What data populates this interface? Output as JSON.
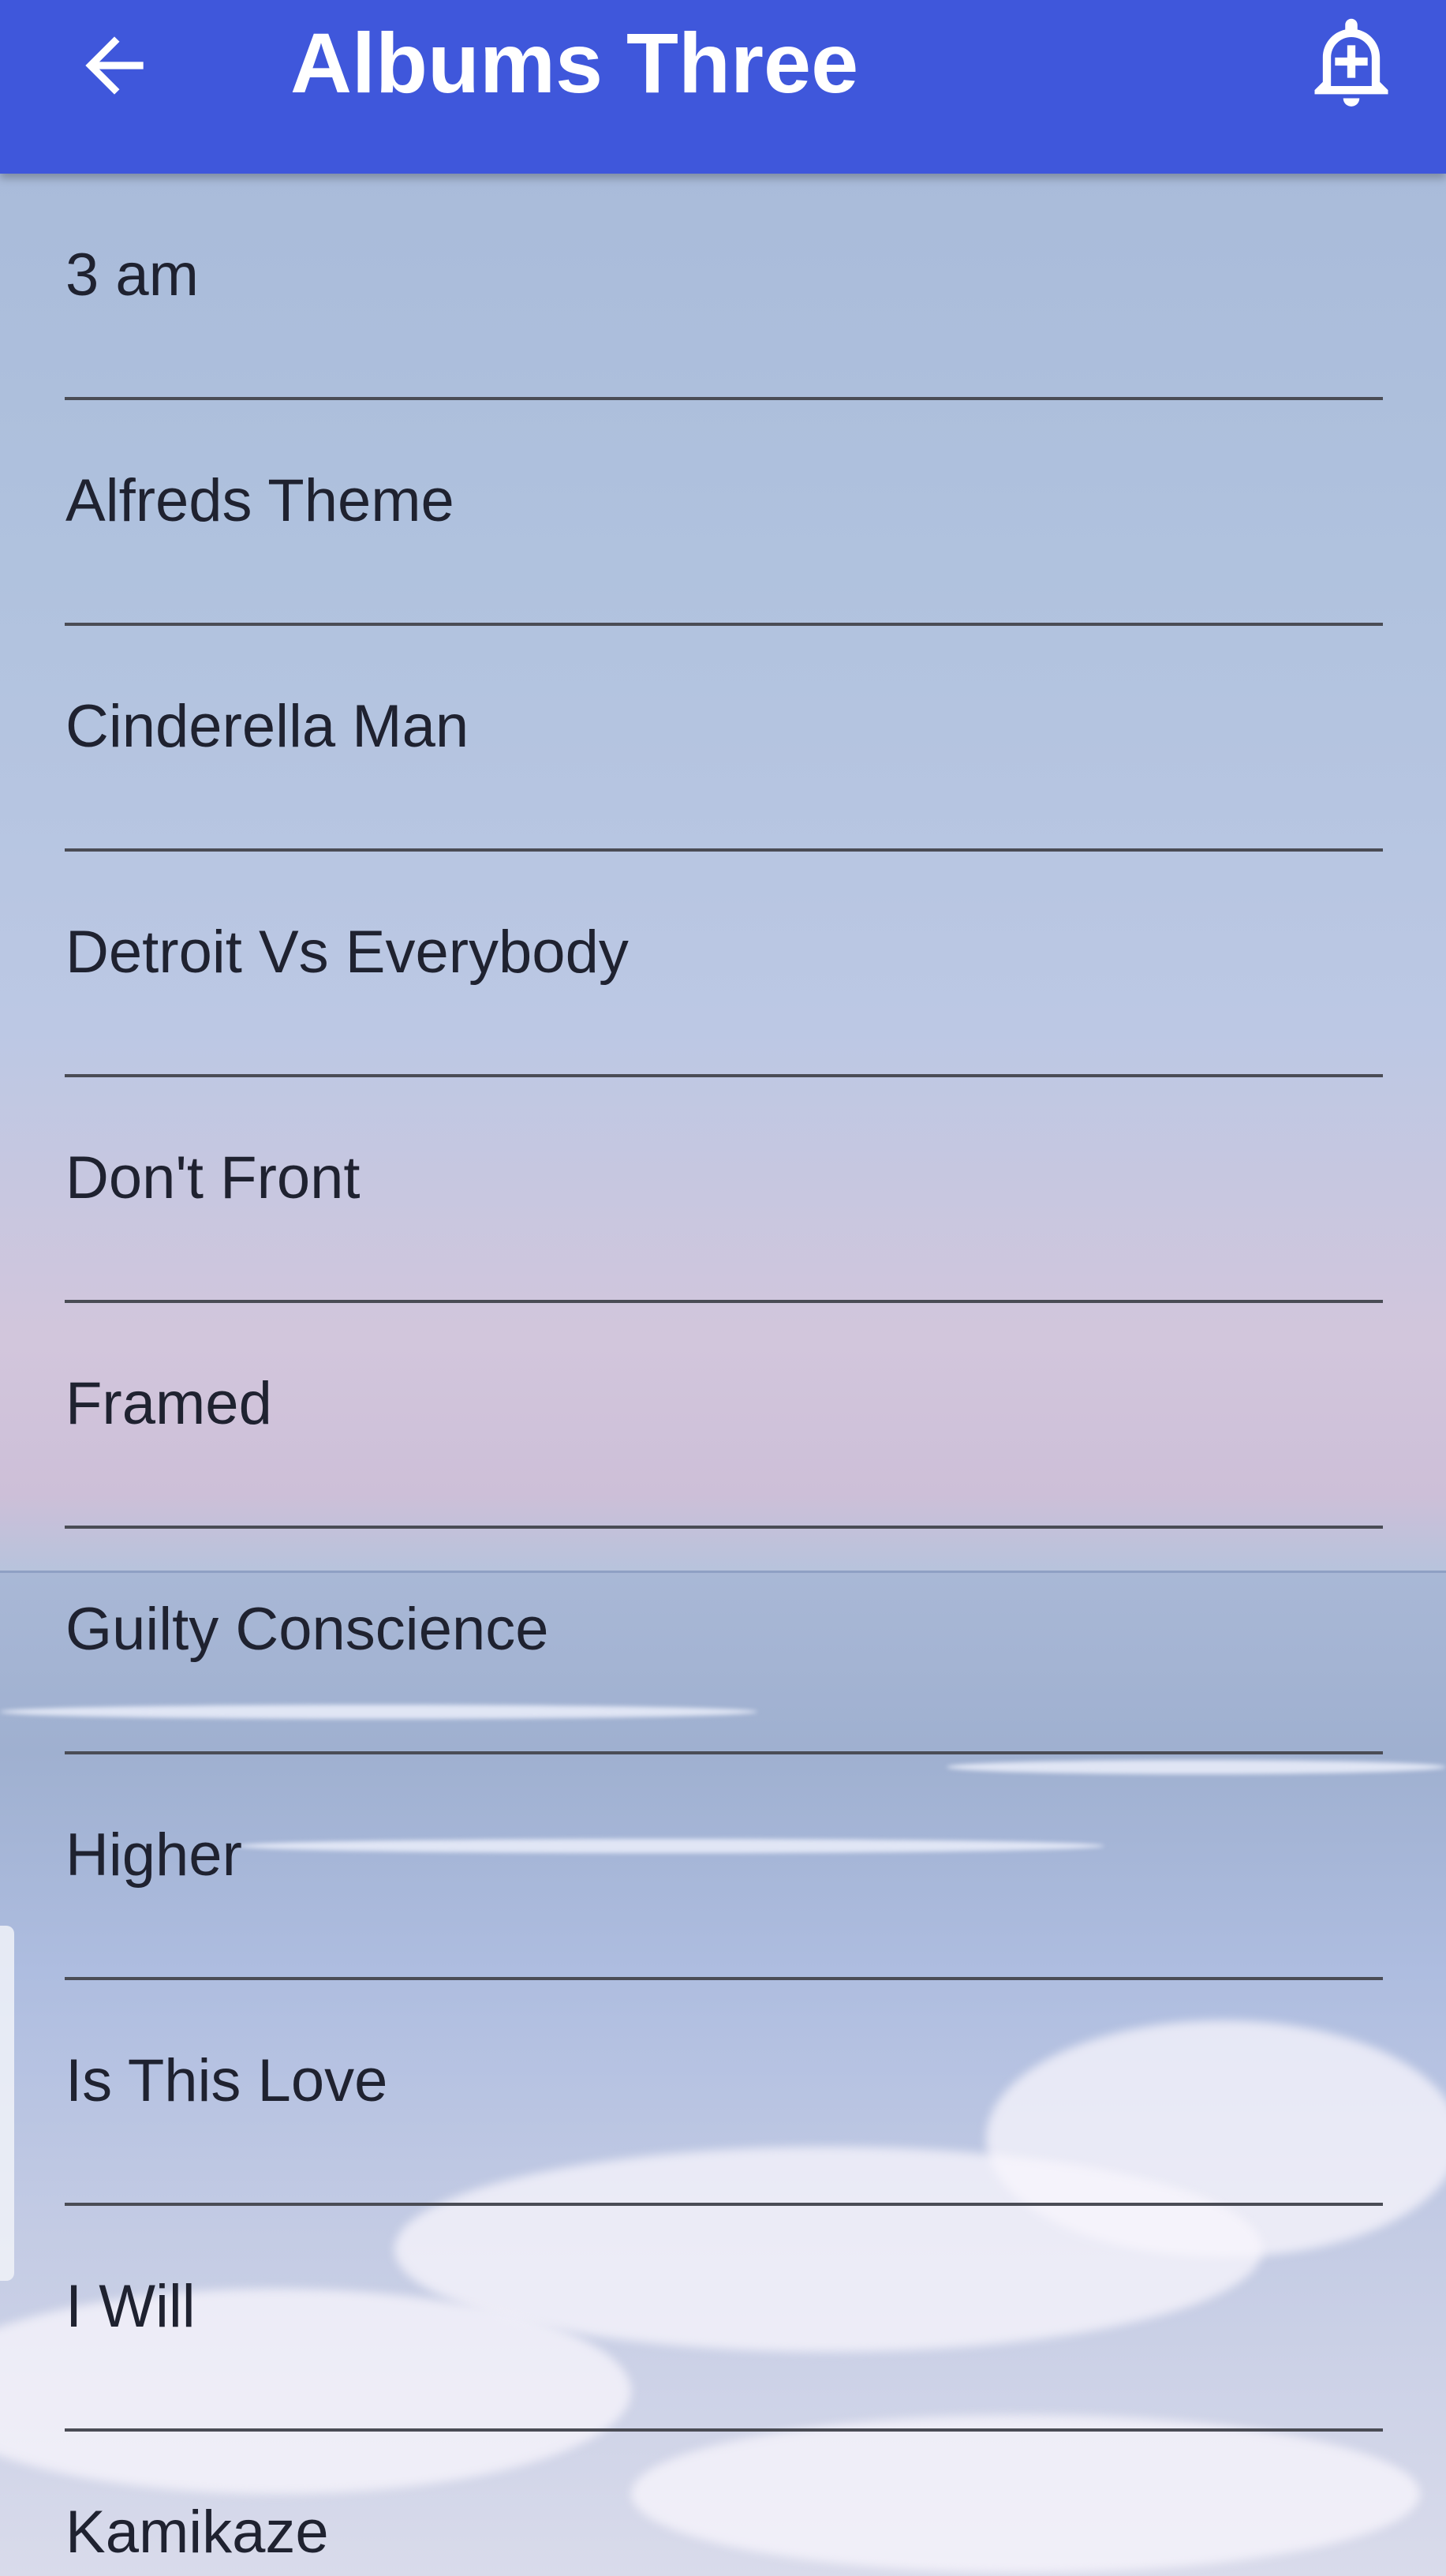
{
  "header": {
    "title": "Albums Three",
    "back_icon": "arrow-back-icon",
    "action_icon": "alarm-add-icon",
    "background_color": "#3f57db"
  },
  "songs": [
    {
      "label": "3 am"
    },
    {
      "label": "Alfreds Theme"
    },
    {
      "label": "Cinderella Man"
    },
    {
      "label": "Detroit Vs Everybody"
    },
    {
      "label": "Don't Front"
    },
    {
      "label": "Framed"
    },
    {
      "label": "Guilty Conscience"
    },
    {
      "label": "Higher"
    },
    {
      "label": "Is This Love"
    },
    {
      "label": "I Will"
    },
    {
      "label": "Kamikaze"
    }
  ]
}
